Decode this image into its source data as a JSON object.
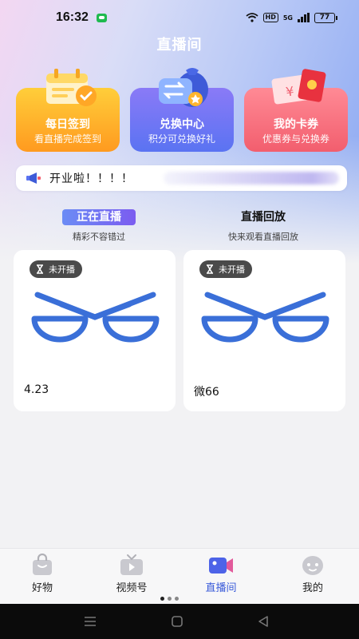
{
  "status_bar": {
    "time": "16:32",
    "hd_label": "HD",
    "network_label": "5G",
    "battery": "77"
  },
  "header": {
    "title": "直播间"
  },
  "features": [
    {
      "title": "每日签到",
      "subtitle": "看直播完成签到",
      "icon": "calendar-check-icon"
    },
    {
      "title": "兑换中心",
      "subtitle": "积分可兑换好礼",
      "icon": "exchange-bag-icon"
    },
    {
      "title": "我的卡券",
      "subtitle": "优惠券与兑换券",
      "icon": "coupon-envelope-icon"
    }
  ],
  "notice": {
    "text": "开业啦！！！！",
    "icon": "megaphone-icon"
  },
  "tabs": [
    {
      "title": "正在直播",
      "subtitle": "精彩不容错过",
      "active": true
    },
    {
      "title": "直播回放",
      "subtitle": "快来观看直播回放",
      "active": false
    }
  ],
  "live_rooms": [
    {
      "status": "未开播",
      "name": "4.23",
      "cover_icon": "glasses-logo-icon"
    },
    {
      "status": "未开播",
      "name": "微66",
      "cover_icon": "glasses-logo-icon"
    }
  ],
  "bottom_nav": [
    {
      "label": "好物",
      "icon": "shopping-bag-icon",
      "active": false
    },
    {
      "label": "视频号",
      "icon": "tv-play-icon",
      "active": false
    },
    {
      "label": "直播间",
      "icon": "live-camera-icon",
      "active": true
    },
    {
      "label": "我的",
      "icon": "profile-face-icon",
      "active": false
    }
  ],
  "colors": {
    "brand_blue": "#3a5bd9",
    "checkin_orange": "#ff9a1f",
    "exchange_purple": "#5a73f2",
    "coupon_red": "#f25e6e"
  }
}
